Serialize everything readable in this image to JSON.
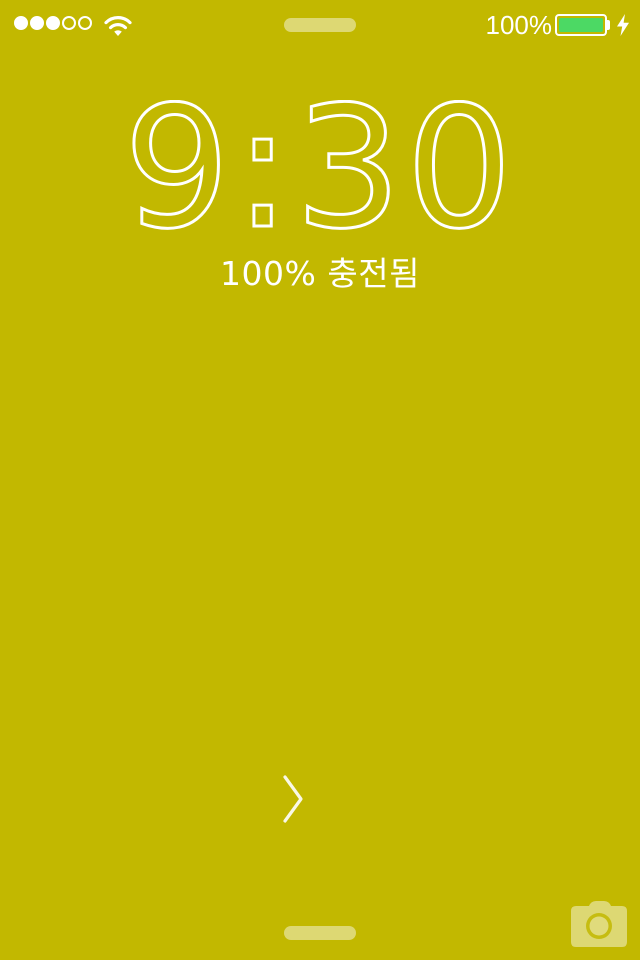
{
  "colors": {
    "background": "#c2b800",
    "battery_fill": "#4cd964",
    "foreground": "#ffffff"
  },
  "status_bar": {
    "signal_strength": 3,
    "signal_max": 5,
    "wifi_icon": "wifi-icon",
    "battery_percent_label": "100%",
    "battery_level": 1.0,
    "charging_icon": "lightning-bolt-icon"
  },
  "lock_screen": {
    "time": "9:30",
    "charge_status": "100% 충전됨",
    "unlock_icon": "chevron-right-icon",
    "camera_icon": "camera-icon"
  }
}
